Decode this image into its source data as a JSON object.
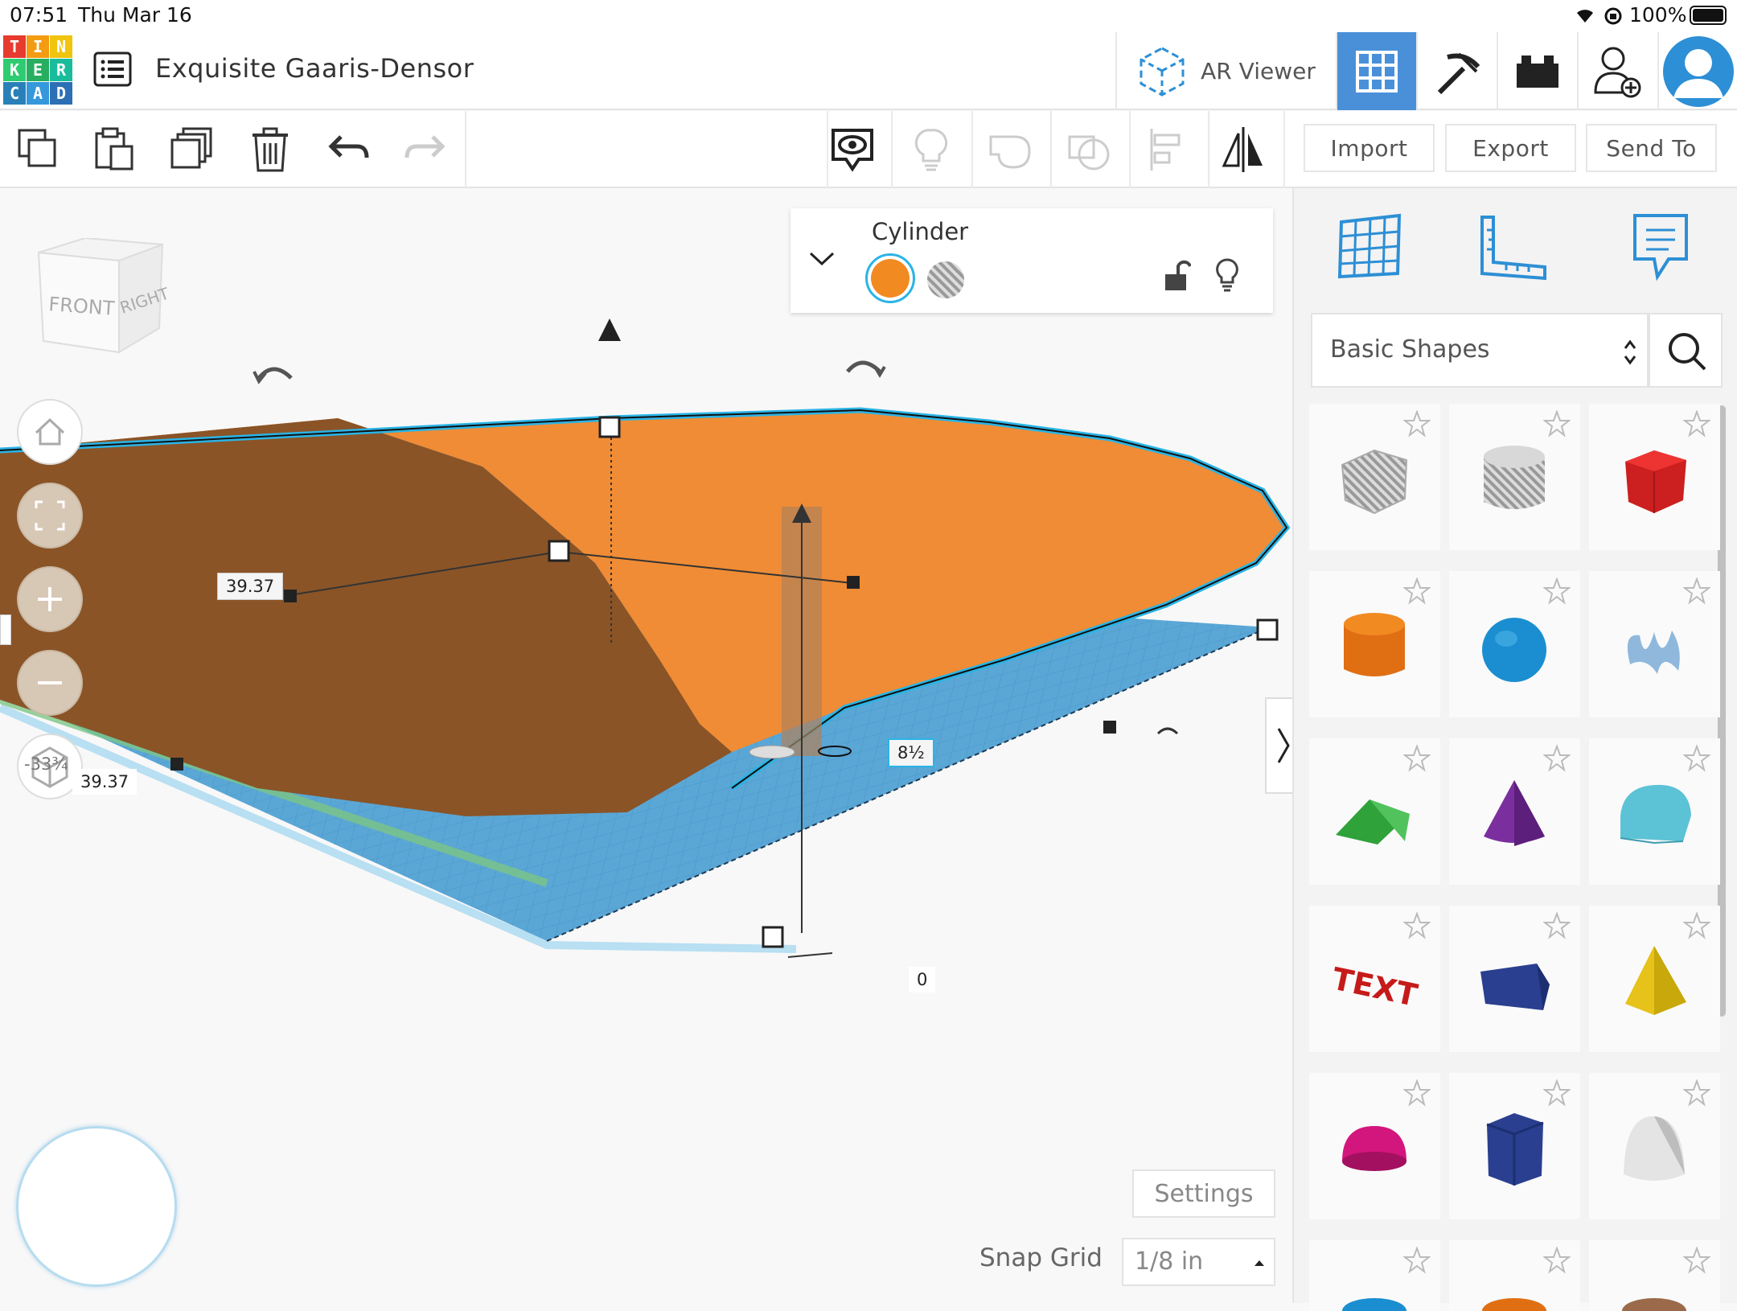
{
  "status_bar": {
    "time": "07:51",
    "date": "Thu Mar 16",
    "battery": "100%"
  },
  "header": {
    "logo_letters": [
      "T",
      "I",
      "N",
      "K",
      "E",
      "R",
      "C",
      "A",
      "D"
    ],
    "project_title": "Exquisite Gaaris-Densor",
    "ar_viewer_label": "AR Viewer"
  },
  "toolbar": {
    "import_label": "Import",
    "export_label": "Export",
    "send_to_label": "Send To"
  },
  "view_cube": {
    "front": "FRONT",
    "right": "RIGHT"
  },
  "inspector": {
    "shape_name": "Cylinder",
    "solid_color": "#f28a22"
  },
  "dimensions": {
    "width_label": "39.37",
    "length_label": "39.37",
    "height_label": "8½",
    "elevation_label": "0",
    "rotation_readout": "-33¾"
  },
  "workplane": {
    "settings_label": "Settings",
    "snap_grid_label": "Snap Grid",
    "snap_grid_value": "1/8 in"
  },
  "shapes_panel": {
    "category": "Basic Shapes",
    "shapes": [
      {
        "name": "Box Hole"
      },
      {
        "name": "Cylinder Hole"
      },
      {
        "name": "Box"
      },
      {
        "name": "Cylinder"
      },
      {
        "name": "Sphere"
      },
      {
        "name": "Scribble"
      },
      {
        "name": "Roof"
      },
      {
        "name": "Cone"
      },
      {
        "name": "Round Roof"
      },
      {
        "name": "Text"
      },
      {
        "name": "Wedge"
      },
      {
        "name": "Pyramid"
      },
      {
        "name": "Half Sphere"
      },
      {
        "name": "Polygon"
      },
      {
        "name": "Paraboloid"
      }
    ],
    "text_shape_label": "TEXT"
  },
  "colors": {
    "accent_blue": "#2d8fd5",
    "active_tab": "#4a90d9",
    "orange": "#f28a22",
    "dark_orange": "#8a5427",
    "plane_blue": "#4f9fd0"
  }
}
